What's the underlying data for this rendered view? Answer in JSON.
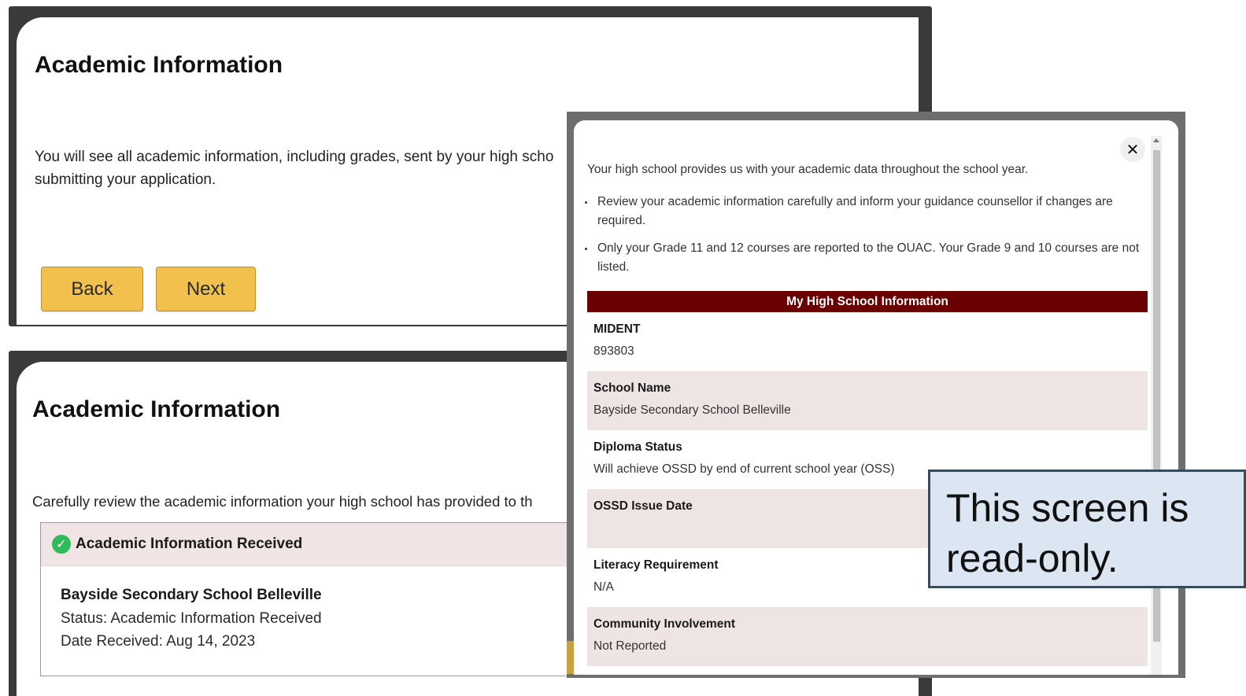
{
  "top_screen": {
    "title": "Academic Information",
    "paragraph_line1": "You will see all academic information, including grades, sent by your high scho",
    "paragraph_line2": "submitting your application.",
    "back_label": "Back",
    "next_label": "Next"
  },
  "bottom_screen": {
    "title": "Academic Information",
    "paragraph": "Carefully review the academic information your high school has provided to th",
    "received": {
      "header": "Academic Information Received",
      "school": "Bayside Secondary School Belleville",
      "status": "Status: Academic Information Received",
      "date": "Date Received: Aug 14, 2023"
    }
  },
  "modal": {
    "close_symbol": "✕",
    "intro": "Your high school provides us with your academic data throughout the school year.",
    "bullets": [
      "Review your academic information carefully and inform your guidance counsellor if changes are required.",
      "Only your Grade 11 and 12 courses are reported to the OUAC. Your Grade 9 and 10 courses are not listed."
    ],
    "table_title": "My High School Information",
    "rows": [
      {
        "label": "MIDENT",
        "value": "893803"
      },
      {
        "label": "School Name",
        "value": "Bayside Secondary School Belleville"
      },
      {
        "label": "Diploma Status",
        "value": "Will achieve OSSD by end of current school year (OSS)"
      },
      {
        "label": "OSSD Issue Date",
        "value": ""
      },
      {
        "label": "Literacy Requirement",
        "value": "N/A"
      },
      {
        "label": "Community Involvement",
        "value": "Not Reported"
      }
    ]
  },
  "callout": {
    "line1": "This screen is",
    "line2": "read-only."
  },
  "colors": {
    "button_yellow": "#f1c04d",
    "table_header_maroon": "#6b0000",
    "row_shade": "#efe4e4",
    "check_green": "#2fbb5a",
    "callout_bg": "#dce6f2",
    "callout_border": "#2f4e62"
  },
  "icons": {
    "check": "check-circle-icon",
    "close": "close-icon"
  }
}
